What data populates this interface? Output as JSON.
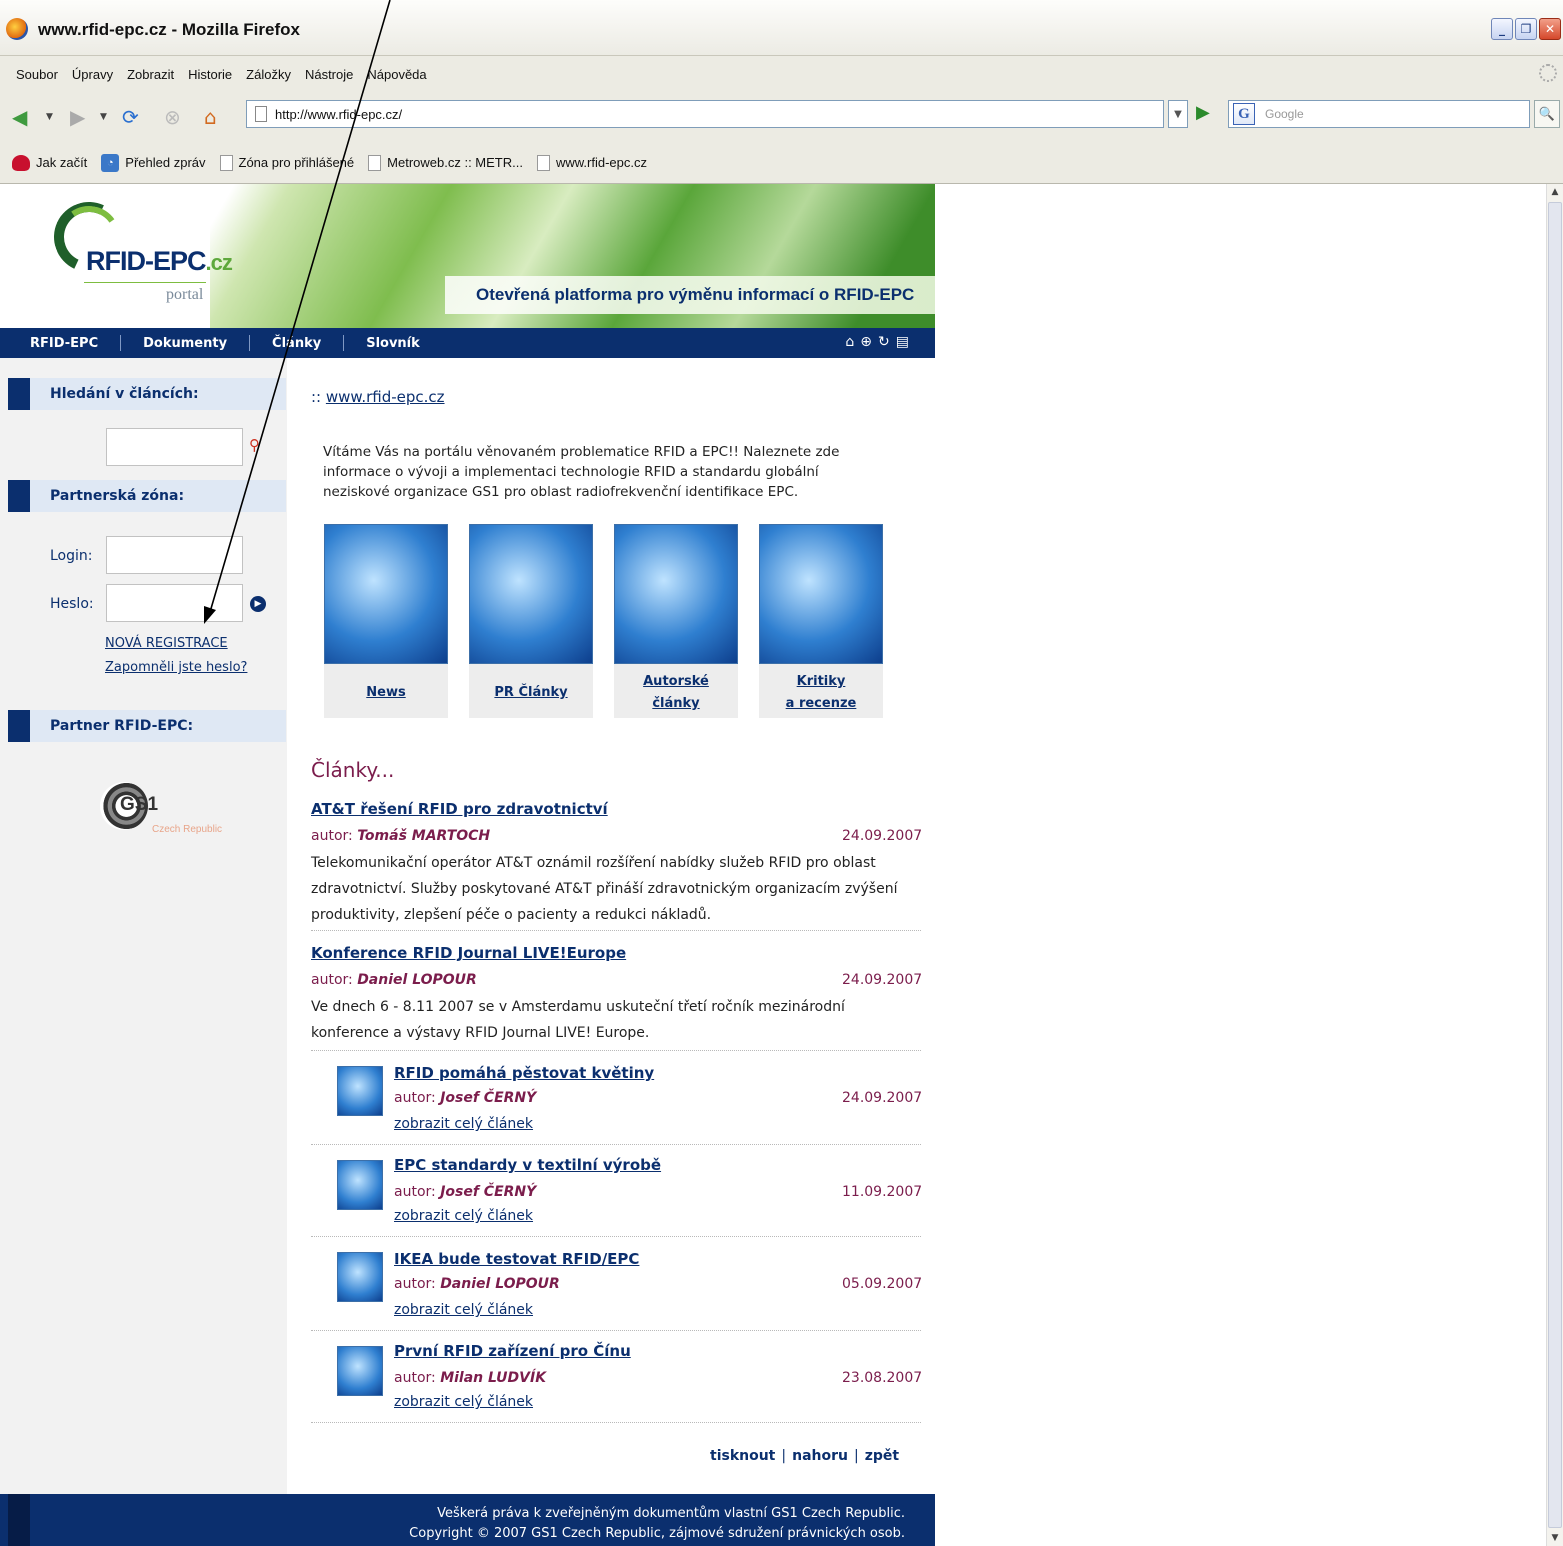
{
  "window": {
    "title": "www.rfid-epc.cz - Mozilla Firefox"
  },
  "menu": [
    "Soubor",
    "Úpravy",
    "Zobrazit",
    "Historie",
    "Záložky",
    "Nástroje",
    "Nápověda"
  ],
  "toolbar": {
    "url": "http://www.rfid-epc.cz/",
    "search_placeholder": "Google"
  },
  "bookmarks": [
    "Jak začít",
    "Přehled zpráv",
    "Zóna pro přihlášené",
    "Metroweb.cz :: METR...",
    "www.rfid-epc.cz"
  ],
  "site": {
    "logo": {
      "name": "RFID-EPC",
      "tld": ".cz",
      "sub": "portal"
    },
    "slogan": "Otevřená platforma pro výměnu informací o RFID-EPC",
    "nav": [
      "RFID-EPC",
      "Dokumenty",
      "Články",
      "Slovník"
    ],
    "sidebar": {
      "search_title": "Hledání v článcích:",
      "partner_zone": "Partnerská zóna:",
      "login_label": "Login:",
      "password_label": "Heslo:",
      "register": "NOVÁ REGISTRACE",
      "forgot": "Zapomněli jste heslo?",
      "partner_title": "Partner RFID-EPC:",
      "partner_logo": "GS1",
      "partner_sub": "Czech Republic"
    },
    "breadcrumb": {
      "prefix": "::",
      "link": "www.rfid-epc.cz"
    },
    "intro": "Vítáme Vás na portálu věnovaném problematice RFID a EPC!! Naleznete zde informace o vývoji a implementaci technologie RFID a standardu globální neziskové organizace GS1 pro oblast radiofrekvenční identifikace EPC.",
    "tiles": [
      {
        "line1": "News",
        "line2": ""
      },
      {
        "line1": "PR Články",
        "line2": ""
      },
      {
        "line1": "Autorské",
        "line2": "články"
      },
      {
        "line1": "Kritiky",
        "line2": "a recenze"
      }
    ],
    "section_title": "Články...",
    "author_prefix": "autor:",
    "articles": [
      {
        "title": "AT&T řešení RFID pro zdravotnictví",
        "author": "Tomáš MARTOCH",
        "date": "24.09.2007",
        "desc": "Telekomunikační operátor AT&T oznámil rozšíření nabídky služeb RFID pro oblast zdravotnictví. Služby poskytované AT&T přináší zdravotnickým organizacím zvýšení produktivity, zlepšení péče o pacienty a redukci nákladů."
      },
      {
        "title": "Konference RFID Journal LIVE!Europe",
        "author": "Daniel LOPOUR",
        "date": "24.09.2007",
        "desc": "Ve dnech 6 - 8.11 2007 se v Amsterdamu uskuteční třetí ročník mezinárodní konference a výstavy RFID Journal LIVE! Europe."
      }
    ],
    "more_label": "zobrazit celý článek",
    "short_articles": [
      {
        "title": "RFID pomáhá pěstovat květiny",
        "author": "Josef ČERNÝ",
        "date": "24.09.2007"
      },
      {
        "title": "EPC standardy v textilní výrobě",
        "author": "Josef ČERNÝ",
        "date": "11.09.2007"
      },
      {
        "title": "IKEA bude testovat RFID/EPC",
        "author": "Daniel LOPOUR",
        "date": "05.09.2007"
      },
      {
        "title": "První RFID zařízení pro Čínu",
        "author": "Milan LUDVÍK",
        "date": "23.08.2007"
      }
    ],
    "bottom_nav": [
      "tisknout",
      "nahoru",
      "zpět"
    ],
    "footer": [
      "Veškerá práva k zveřejněným dokumentům vlastní GS1 Czech Republic.",
      "Copyright © 2007 GS1 Czech Republic, zájmové sdružení právnických osob."
    ]
  }
}
